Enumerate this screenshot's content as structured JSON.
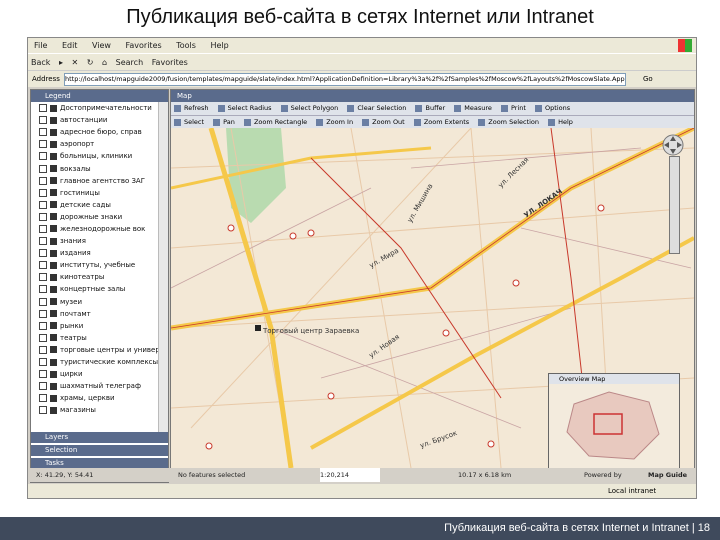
{
  "slide_title": "Публикация веб-сайта в сетях Internet или Intranet",
  "footer_text": "Публикация веб-сайта в сетях Internet и Intranet | 18",
  "browser": {
    "menu": [
      "File",
      "Edit",
      "View",
      "Favorites",
      "Tools",
      "Help"
    ],
    "nav": [
      "Back",
      "",
      "Search",
      "Favorites"
    ],
    "address_label": "Address",
    "url": "http://localhost/mapguide2009/fusion/templates/mapguide/slate/index.html?ApplicationDefinition=Library%3a%2f%2fSamples%2fMoscow%2fLayouts%2fMoscowSlate.ApplicationDefinition",
    "go": "Go",
    "status_zone": "Local intranet"
  },
  "legend": {
    "header": "Legend",
    "layers": [
      "Достопримечательности",
      "автостанции",
      "адресное бюро, справ",
      "аэропорт",
      "больницы, клиники",
      "вокзалы",
      "главное агентство ЗАГ",
      "гостиницы",
      "детские сады",
      "дорожные знаки",
      "железнодорожные вок",
      "знания",
      "издания",
      "институты, учебные",
      "кинотеатры",
      "концертные залы",
      "музеи",
      "почтамт",
      "рынки",
      "театры",
      "торговые центры и универ",
      "туристические комплексы",
      "цирки",
      "шахматный телеграф",
      "храмы, церкви",
      "магазины"
    ],
    "folder": "Layers",
    "selection": "Selection",
    "tasks": "Tasks"
  },
  "map": {
    "header": "Map",
    "toolbar1": [
      "Refresh",
      "Select Radius",
      "Select Polygon",
      "Clear Selection",
      "Buffer",
      "Measure",
      "Print",
      "Options"
    ],
    "toolbar2": [
      "Select",
      "Pan",
      "Zoom Rectangle",
      "Zoom In",
      "Zoom Out",
      "Zoom Extents",
      "Zoom Selection",
      "Help"
    ],
    "labels": [
      "ул. Мира",
      "ул. Мишина",
      "ул. Лесная",
      "ул. Новая",
      "ПЛАНЕРНАЯ УЛ.",
      "УЛ. ЛОКАЧ",
      "ул. Брусок",
      "Торговый центр Зараевка"
    ],
    "overview_title": "Overview Map",
    "status": {
      "coords": "X: 41.29, Y: 54.41",
      "selected": "No features selected",
      "scale": "1:20,214",
      "size": "10.17 x 6.18 km",
      "powered": "Powered by",
      "brand": "Map Guide"
    }
  },
  "colors": {
    "header": "#5a6b8c",
    "road_yellow": "#f5c84a",
    "road_red": "#c8392b",
    "map_bg": "#f3e8d6",
    "footer": "#3f4a5c"
  }
}
